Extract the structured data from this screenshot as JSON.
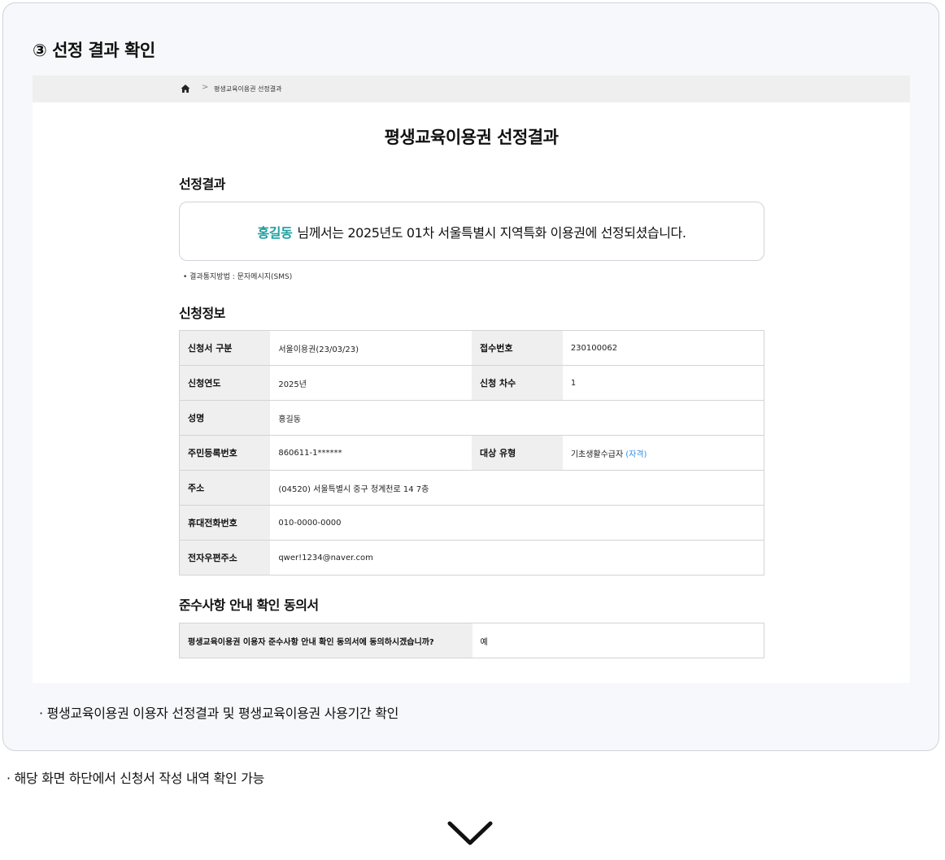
{
  "step_title": "③ 선정 결과 확인",
  "breadcrumb": {
    "home_icon": "home-icon",
    "separator": ">",
    "current": "평생교육이용권 선정결과"
  },
  "page_title": "평생교육이용권 선정결과",
  "result_section": {
    "heading": "선정결과",
    "name": "홍길동",
    "message": "님께서는 2025년도 01차 서울특별시 지역특화 이용권에 선정되셨습니다.",
    "notify_method": "• 결과통지방법 : 문자메시지(SMS)",
    "name_color": "#1f9f9f"
  },
  "application_section": {
    "heading": "신청정보",
    "rows": [
      {
        "label1": "신청서 구분",
        "value1": "서울이용권(23/03/23)",
        "label2": "접수번호",
        "value2": "230100062"
      },
      {
        "label1": "신청연도",
        "value1": "2025년",
        "label2": "신청 차수",
        "value2": "1"
      },
      {
        "label1": "성명",
        "value1": "홍길동"
      },
      {
        "label1": "주민등록번호",
        "value1": "860611-1******",
        "label2": "대상 유형",
        "value2": "기초생활수급자",
        "value2_extra": "(자격)"
      },
      {
        "label1": "주소",
        "value1": "(04520) 서울특별시 중구 청계천로 14 7층"
      },
      {
        "label1": "휴대전화번호",
        "value1": "010-0000-0000"
      },
      {
        "label1": "전자우편주소",
        "value1": "qwer!1234@naver.com"
      }
    ]
  },
  "agreement_section": {
    "heading": "준수사항 안내 확인 동의서",
    "question": "평생교육이용권 이용자 준수사항 안내 확인 동의서에 동의하시겠습니까?",
    "answer": "예"
  },
  "caption_inner": "· 평생교육이용권 이용자 선정결과 및 평생교육이용권 사용기간 확인",
  "caption_outer": "· 해당 화면 하단에서 신청서 작성 내역 확인 가능",
  "chevron_icon": "chevron-down-icon"
}
